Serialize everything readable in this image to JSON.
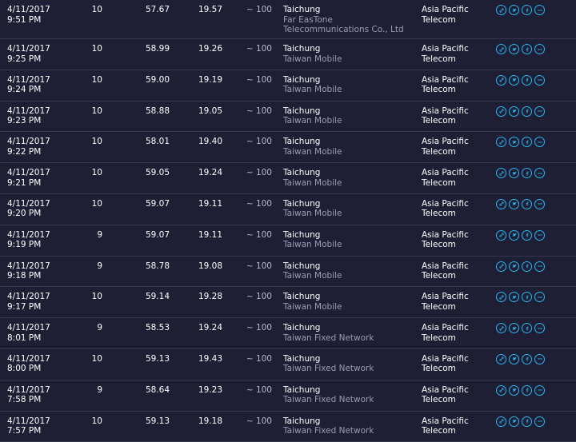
{
  "distance_label": "~ 100",
  "rows": [
    {
      "date": "4/11/2017",
      "time": "9:51 PM",
      "ping": "10",
      "download": "57.67",
      "upload": "19.57",
      "city": "Taichung",
      "sponsor": "Far EasTone Telecommunications Co., Ltd",
      "isp1": "Asia Pacific",
      "isp2": "Telecom"
    },
    {
      "date": "4/11/2017",
      "time": "9:25 PM",
      "ping": "10",
      "download": "58.99",
      "upload": "19.26",
      "city": "Taichung",
      "sponsor": "Taiwan Mobile",
      "isp1": "Asia Pacific",
      "isp2": "Telecom"
    },
    {
      "date": "4/11/2017",
      "time": "9:24 PM",
      "ping": "10",
      "download": "59.00",
      "upload": "19.19",
      "city": "Taichung",
      "sponsor": "Taiwan Mobile",
      "isp1": "Asia Pacific",
      "isp2": "Telecom"
    },
    {
      "date": "4/11/2017",
      "time": "9:23 PM",
      "ping": "10",
      "download": "58.88",
      "upload": "19.05",
      "city": "Taichung",
      "sponsor": "Taiwan Mobile",
      "isp1": "Asia Pacific",
      "isp2": "Telecom"
    },
    {
      "date": "4/11/2017",
      "time": "9:22 PM",
      "ping": "10",
      "download": "58.01",
      "upload": "19.40",
      "city": "Taichung",
      "sponsor": "Taiwan Mobile",
      "isp1": "Asia Pacific",
      "isp2": "Telecom"
    },
    {
      "date": "4/11/2017",
      "time": "9:21 PM",
      "ping": "10",
      "download": "59.05",
      "upload": "19.24",
      "city": "Taichung",
      "sponsor": "Taiwan Mobile",
      "isp1": "Asia Pacific",
      "isp2": "Telecom"
    },
    {
      "date": "4/11/2017",
      "time": "9:20 PM",
      "ping": "10",
      "download": "59.07",
      "upload": "19.11",
      "city": "Taichung",
      "sponsor": "Taiwan Mobile",
      "isp1": "Asia Pacific",
      "isp2": "Telecom"
    },
    {
      "date": "4/11/2017",
      "time": "9:19 PM",
      "ping": "9",
      "download": "59.07",
      "upload": "19.11",
      "city": "Taichung",
      "sponsor": "Taiwan Mobile",
      "isp1": "Asia Pacific",
      "isp2": "Telecom"
    },
    {
      "date": "4/11/2017",
      "time": "9:18 PM",
      "ping": "9",
      "download": "58.78",
      "upload": "19.08",
      "city": "Taichung",
      "sponsor": "Taiwan Mobile",
      "isp1": "Asia Pacific",
      "isp2": "Telecom"
    },
    {
      "date": "4/11/2017",
      "time": "9:17 PM",
      "ping": "10",
      "download": "59.14",
      "upload": "19.28",
      "city": "Taichung",
      "sponsor": "Taiwan Mobile",
      "isp1": "Asia Pacific",
      "isp2": "Telecom"
    },
    {
      "date": "4/11/2017",
      "time": "8:01 PM",
      "ping": "9",
      "download": "58.53",
      "upload": "19.24",
      "city": "Taichung",
      "sponsor": "Taiwan Fixed Network",
      "isp1": "Asia Pacific",
      "isp2": "Telecom"
    },
    {
      "date": "4/11/2017",
      "time": "8:00 PM",
      "ping": "10",
      "download": "59.13",
      "upload": "19.43",
      "city": "Taichung",
      "sponsor": "Taiwan Fixed Network",
      "isp1": "Asia Pacific",
      "isp2": "Telecom"
    },
    {
      "date": "4/11/2017",
      "time": "7:58 PM",
      "ping": "9",
      "download": "58.64",
      "upload": "19.23",
      "city": "Taichung",
      "sponsor": "Taiwan Fixed Network",
      "isp1": "Asia Pacific",
      "isp2": "Telecom"
    },
    {
      "date": "4/11/2017",
      "time": "7:57 PM",
      "ping": "10",
      "download": "59.13",
      "upload": "19.18",
      "city": "Taichung",
      "sponsor": "Taiwan Fixed Network",
      "isp1": "Asia Pacific",
      "isp2": "Telecom"
    }
  ],
  "share_icons": [
    "link-icon",
    "twitter-icon",
    "facebook-icon",
    "more-icon"
  ],
  "colors": {
    "background": "#1e1f34",
    "divider": "#35374f",
    "accent": "#29b6f6",
    "secondary_text": "#9a9cb8"
  }
}
